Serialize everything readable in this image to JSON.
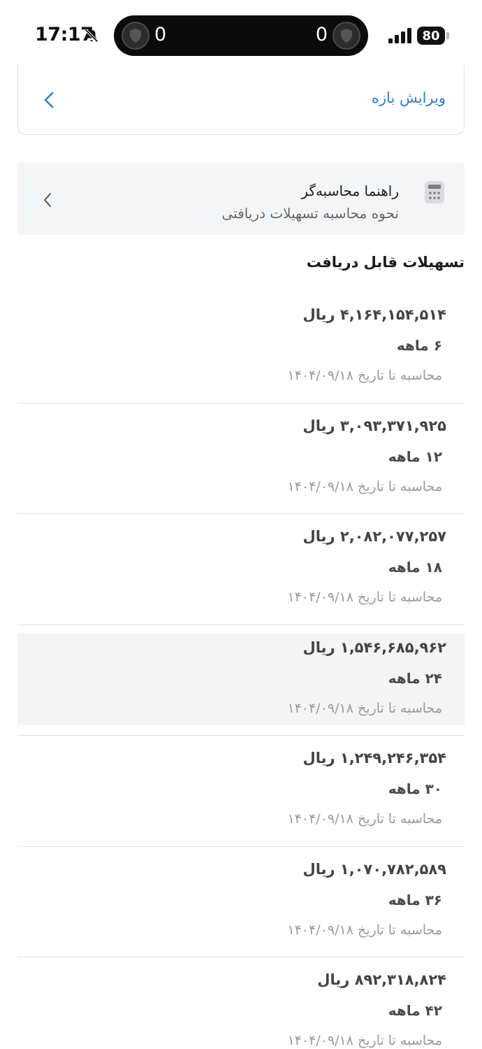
{
  "status_bar": {
    "time": "17:17",
    "score_left": "0",
    "score_right": "0",
    "battery": "80",
    "icons": [
      "bell-muted-icon",
      "shield-icon",
      "signal-icon",
      "battery-icon"
    ]
  },
  "edit_range": {
    "label": "ویرایش بازه",
    "icon": "chevron-left-icon"
  },
  "guide": {
    "title": "راهنما محاسبه‌گر",
    "subtitle": "نحوه محاسبه تسهیلات دریافتی",
    "icon": "calculator-icon"
  },
  "section": {
    "title": "تسهیلات قابل دریافت"
  },
  "loans": [
    {
      "amount": "۴,۱۶۴,۱۵۴,۵۱۴ ریال",
      "term": "۶ ماهه",
      "date": "محاسبه تا تاریخ ۱۴۰۴/۰۹/۱۸"
    },
    {
      "amount": "۳,۰۹۳,۳۷۱,۹۲۵ ریال",
      "term": "۱۲ ماهه",
      "date": "محاسبه تا تاریخ ۱۴۰۴/۰۹/۱۸"
    },
    {
      "amount": "۲,۰۸۲,۰۷۷,۲۵۷ ریال",
      "term": "۱۸ ماهه",
      "date": "محاسبه تا تاریخ ۱۴۰۴/۰۹/۱۸"
    },
    {
      "amount": "۱,۵۴۶,۶۸۵,۹۶۲ ریال",
      "term": "۲۴ ماهه",
      "date": "محاسبه تا تاریخ ۱۴۰۴/۰۹/۱۸"
    },
    {
      "amount": "۱,۲۴۹,۲۴۶,۳۵۴ ریال",
      "term": "۳۰ ماهه",
      "date": "محاسبه تا تاریخ ۱۴۰۴/۰۹/۱۸"
    },
    {
      "amount": "۱,۰۷۰,۷۸۲,۵۸۹ ریال",
      "term": "۳۶ ماهه",
      "date": "محاسبه تا تاریخ ۱۴۰۴/۰۹/۱۸"
    },
    {
      "amount": "۸۹۲,۳۱۸,۸۲۴ ریال",
      "term": "۴۲ ماهه",
      "date": "محاسبه تا تاریخ ۱۴۰۴/۰۹/۱۸"
    }
  ],
  "colors": {
    "accent": "#2f80c4",
    "card_bg": "#f4f5f7",
    "selected_bg": "#f4f4f4",
    "divider": "#e3e3e3"
  }
}
